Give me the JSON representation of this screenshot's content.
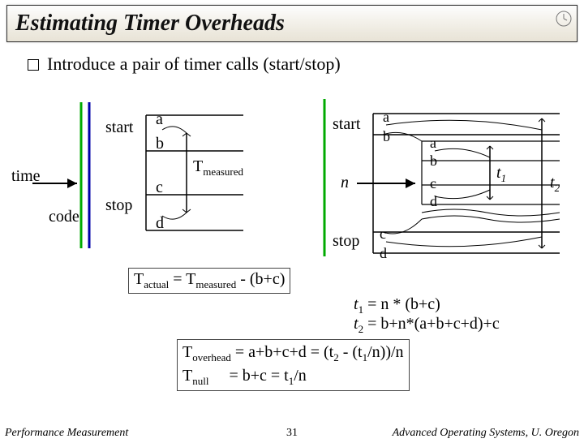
{
  "title": "Estimating Timer Overheads",
  "bullet": "Introduce a pair of timer calls (start/stop)",
  "left": {
    "time": "time",
    "code": "code",
    "start": "start",
    "stop": "stop",
    "a": "a",
    "b": "b",
    "c": "c",
    "d": "d",
    "Tmeas": "T",
    "Tmeas_sub": "measured"
  },
  "right": {
    "start": "start",
    "stop": "stop",
    "n": "n",
    "a1": "a",
    "b1": "b",
    "a2": "a",
    "b2": "b",
    "c2": "c",
    "d2": "d",
    "c1": "c",
    "d1": "d",
    "t1": "t",
    "t1sub": "1",
    "t2": "t",
    "t2sub": "2"
  },
  "eq1_pre": "T",
  "eq1_sub1": "actual",
  "eq1_mid": " = T",
  "eq1_sub2": "measured",
  "eq1_post": " - (b+c)",
  "eq2a_pre": "t",
  "eq2a_sub": "1",
  "eq2a_post": " = n * (b+c)",
  "eq2b_pre": "t",
  "eq2b_sub": "2",
  "eq2b_post": " = b+n*(a+b+c+d)+c",
  "eq3_l1_pre": "T",
  "eq3_l1_sub1": "overhead",
  "eq3_l1_mid": " = a+b+c+d = (t",
  "eq3_l1_sub2": "2",
  "eq3_l1_mid2": " - (t",
  "eq3_l1_sub3": "1",
  "eq3_l1_post": "/n))/n",
  "eq3_l2_pre": "T",
  "eq3_l2_sub1": "null",
  "eq3_l2_mid": "     = b+c = t",
  "eq3_l2_sub2": "1",
  "eq3_l2_post": "/n",
  "footer_left": "Performance Measurement",
  "footer_right": "Advanced Operating Systems, U. Oregon",
  "page": "31",
  "chart_data": {
    "type": "diagram",
    "left_timeline": {
      "events_top_to_bottom": [
        "start:a",
        "start:b",
        "code",
        "stop:c",
        "stop:d"
      ],
      "measured_span": "b→c",
      "label": "T_measured"
    },
    "right_timeline": {
      "outer_span_labels": [
        "start:a",
        "start:b",
        "n iterations of {a,b,c,d}",
        "stop:c",
        "stop:d"
      ],
      "brackets": {
        "t1": "n*(b+c)",
        "t2": "b+n*(a+b+c+d)+c"
      }
    },
    "equations": [
      "T_actual = T_measured - (b+c)",
      "t1 = n*(b+c)",
      "t2 = b + n*(a+b+c+d) + c",
      "T_overhead = a+b+c+d = (t2 - (t1/n))/n",
      "T_null = b+c = t1/n"
    ]
  }
}
